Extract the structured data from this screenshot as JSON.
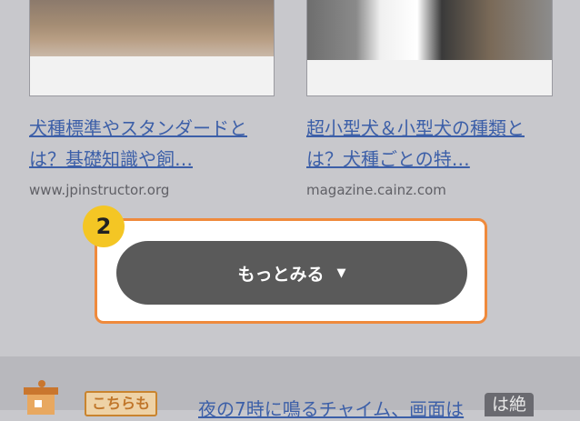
{
  "cards": [
    {
      "title": "犬種標準やスタンダードとは？基礎知識や飼…",
      "domain": "www.jpinstructor.org"
    },
    {
      "title": "超小型犬＆小型犬の種類とは？犬種ごとの特…",
      "domain": "magazine.cainz.com"
    }
  ],
  "step_number": "2",
  "more_button": {
    "label": "もっとみる",
    "icon": "triangle-down-icon"
  },
  "bottom": {
    "badge": "こちらも",
    "headline": "夜の7時に鳴るチャイム、画面は",
    "overlay_badge": "は絶"
  },
  "colors": {
    "accent": "#ef8a3c",
    "step_badge": "#f4c624",
    "link": "#3c5fa8",
    "button": "#5a5a5a"
  }
}
